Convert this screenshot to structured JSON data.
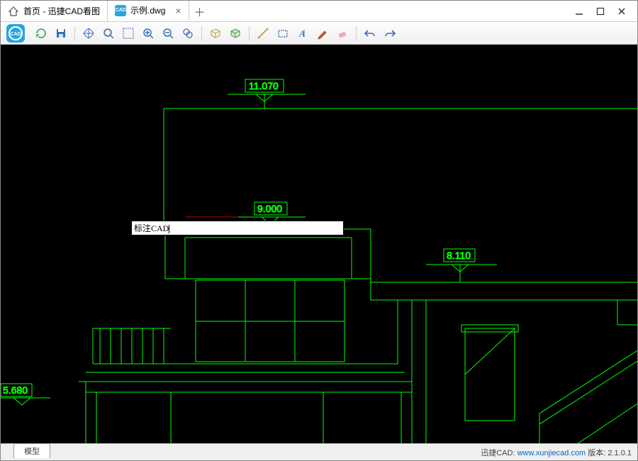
{
  "tabs": {
    "home_label": "首页 - 迅捷CAD看图",
    "file_label": "示例.dwg"
  },
  "toolbar": {
    "icons": [
      "refresh",
      "save",
      "pan",
      "zoom-extent",
      "zoom-window",
      "zoom-in",
      "zoom-out",
      "zoom-realtime",
      "views-3d",
      "views-iso",
      "measure",
      "area",
      "text",
      "modify",
      "erase",
      "undo",
      "redo"
    ]
  },
  "text_input": {
    "value": "标注CAD"
  },
  "drawing": {
    "dim_top": "11.070",
    "dim_mid": "9.000",
    "dim_right": "8.110",
    "dim_left": "5.680"
  },
  "status": {
    "model_tab": "模型",
    "brand": "迅捷CAD:",
    "url": "www.xunjiecad.com",
    "version_label": "版本:",
    "version": "2.1.0.1"
  }
}
